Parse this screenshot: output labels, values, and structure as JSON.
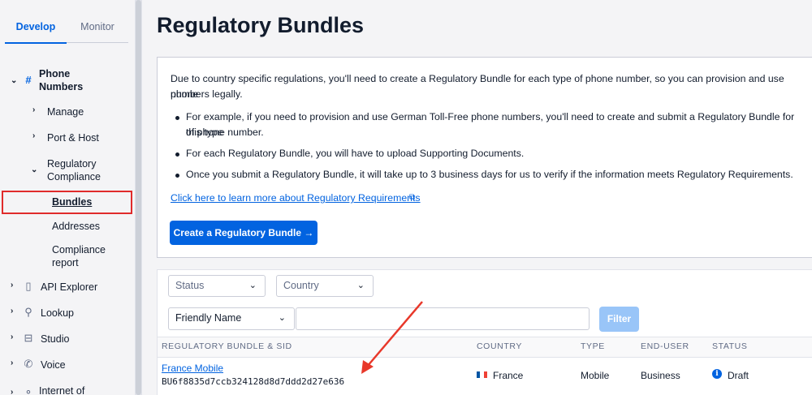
{
  "sidebar": {
    "tabs": {
      "develop": "Develop",
      "monitor": "Monitor"
    },
    "phone_numbers": {
      "line1": "Phone",
      "line2": "Numbers"
    },
    "manage": "Manage",
    "port_host": "Port & Host",
    "regulatory": {
      "line1": "Regulatory",
      "line2": "Compliance"
    },
    "bundles": "Bundles",
    "addresses": "Addresses",
    "compliance_report": {
      "line1": "Compliance",
      "line2": "report"
    },
    "api_explorer": "API Explorer",
    "lookup": "Lookup",
    "studio": "Studio",
    "voice": "Voice",
    "internet_of": "Internet of"
  },
  "main": {
    "title": "Regulatory Bundles",
    "intro_line1": "Due to country specific regulations, you'll need to create a Regulatory Bundle for each type of phone number, so you can provision and use phone",
    "intro_line2": "numbers legally.",
    "bullet1_line1": "For example, if you need to provision and use German Toll-Free phone numbers, you'll need to create and submit a Regulatory Bundle for this type",
    "bullet1_line2": "of phone number.",
    "bullet2": "For each Regulatory Bundle, you will have to upload Supporting Documents.",
    "bullet3": "Once you submit a Regulatory Bundle, it will take up to 3 business days for us to verify if the information meets Regulatory Requirements.",
    "learn_link": "Click here to learn more about Regulatory Requirements",
    "create_button": "Create a Regulatory Bundle →"
  },
  "filters": {
    "status": "Status",
    "country": "Country",
    "friendly_name": "Friendly Name",
    "search_value": "",
    "filter_button": "Filter"
  },
  "table": {
    "headers": {
      "bundle_sid": "REGULATORY BUNDLE & SID",
      "country": "COUNTRY",
      "type": "TYPE",
      "end_user": "END-USER",
      "status": "STATUS"
    },
    "rows": [
      {
        "name": "France Mobile",
        "sid": "BU6f8835d7ccb324128d8d7ddd2d27e636",
        "country": "France",
        "type": "Mobile",
        "end_user": "Business",
        "status": "Draft"
      }
    ]
  },
  "colors": {
    "accent": "#0263e0",
    "highlight": "#e02b2b"
  }
}
